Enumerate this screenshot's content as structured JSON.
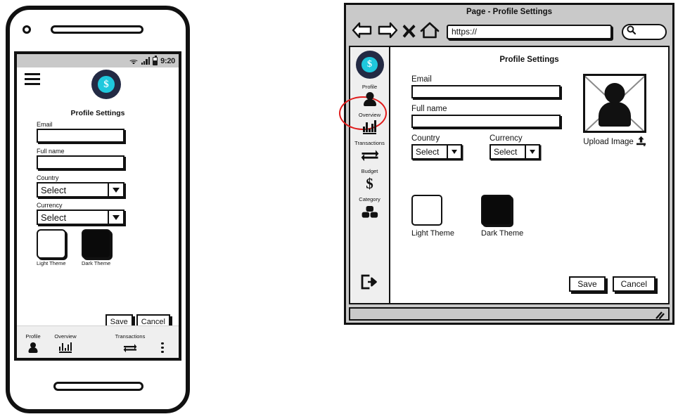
{
  "brand": {
    "logo_text": "$",
    "logo_name": "savvy-budget-logo"
  },
  "mobile": {
    "status_bar": {
      "time": "9:20",
      "wifi_icon": "wifi-icon",
      "signal_icon": "signal-bars-icon",
      "battery_icon": "battery-icon"
    },
    "menu_icon": "hamburger-menu-icon",
    "title": "Profile Settings",
    "fields": {
      "email_label": "Email",
      "email_value": "",
      "fullname_label": "Full name",
      "fullname_value": "",
      "country_label": "Country",
      "country_value": "Select",
      "currency_label": "Currency",
      "currency_value": "Select"
    },
    "themes": [
      {
        "caption": "Light Theme",
        "variant": "light"
      },
      {
        "caption": "Dark Theme",
        "variant": "dark"
      }
    ],
    "buttons": {
      "save": "Save",
      "cancel": "Cancel"
    },
    "fabs": [
      {
        "name": "add-orange-fab",
        "color": "#f0951c"
      },
      {
        "name": "add-green-fab",
        "color": "#1aa832"
      },
      {
        "name": "add-primary-fab",
        "color": "#2b7de9"
      }
    ],
    "bottom_nav": [
      {
        "label": "Profile",
        "icon": "person-icon"
      },
      {
        "label": "Overview",
        "icon": "bar-chart-icon"
      },
      {
        "label": "",
        "icon": "plus-icon"
      },
      {
        "label": "Transactions",
        "icon": "transfer-arrows-icon"
      },
      {
        "label": "",
        "icon": "more-vertical-icon"
      }
    ]
  },
  "browser": {
    "window_title": "Page - Profile Settings",
    "toolbar": {
      "back_icon": "back-arrow-icon",
      "forward_icon": "forward-arrow-icon",
      "stop_icon": "stop-x-icon",
      "home_icon": "home-icon",
      "url_value": "https://",
      "url_placeholder": "https://",
      "search_icon": "search-icon",
      "search_value": ""
    },
    "resize_grip_icon": "resize-grip-icon",
    "sidebar": {
      "highlight_color": "#e01b1b",
      "items": [
        {
          "label": "Profile",
          "icon": "person-icon",
          "active": true
        },
        {
          "label": "Overview",
          "icon": "bar-chart-icon",
          "active": false
        },
        {
          "label": "Transactions",
          "icon": "transfer-arrows-icon",
          "active": false
        },
        {
          "label": "Budget",
          "icon": "dollar-sign-icon",
          "active": false
        },
        {
          "label": "Category",
          "icon": "blocks-icon",
          "active": false
        }
      ],
      "logout_icon": "logout-icon"
    },
    "main": {
      "title": "Profile Settings",
      "fields": {
        "email_label": "Email",
        "email_value": "",
        "fullname_label": "Full name",
        "fullname_value": "",
        "country_label": "Country",
        "country_value": "Select",
        "currency_label": "Currency",
        "currency_value": "Select"
      },
      "upload": {
        "caption": "Upload Image",
        "icon": "upload-icon",
        "placeholder_icon": "person-placeholder-icon"
      },
      "themes": [
        {
          "caption": "Light Theme",
          "variant": "light"
        },
        {
          "caption": "Dark Theme",
          "variant": "dark"
        }
      ],
      "buttons": {
        "save": "Save",
        "cancel": "Cancel"
      }
    }
  }
}
